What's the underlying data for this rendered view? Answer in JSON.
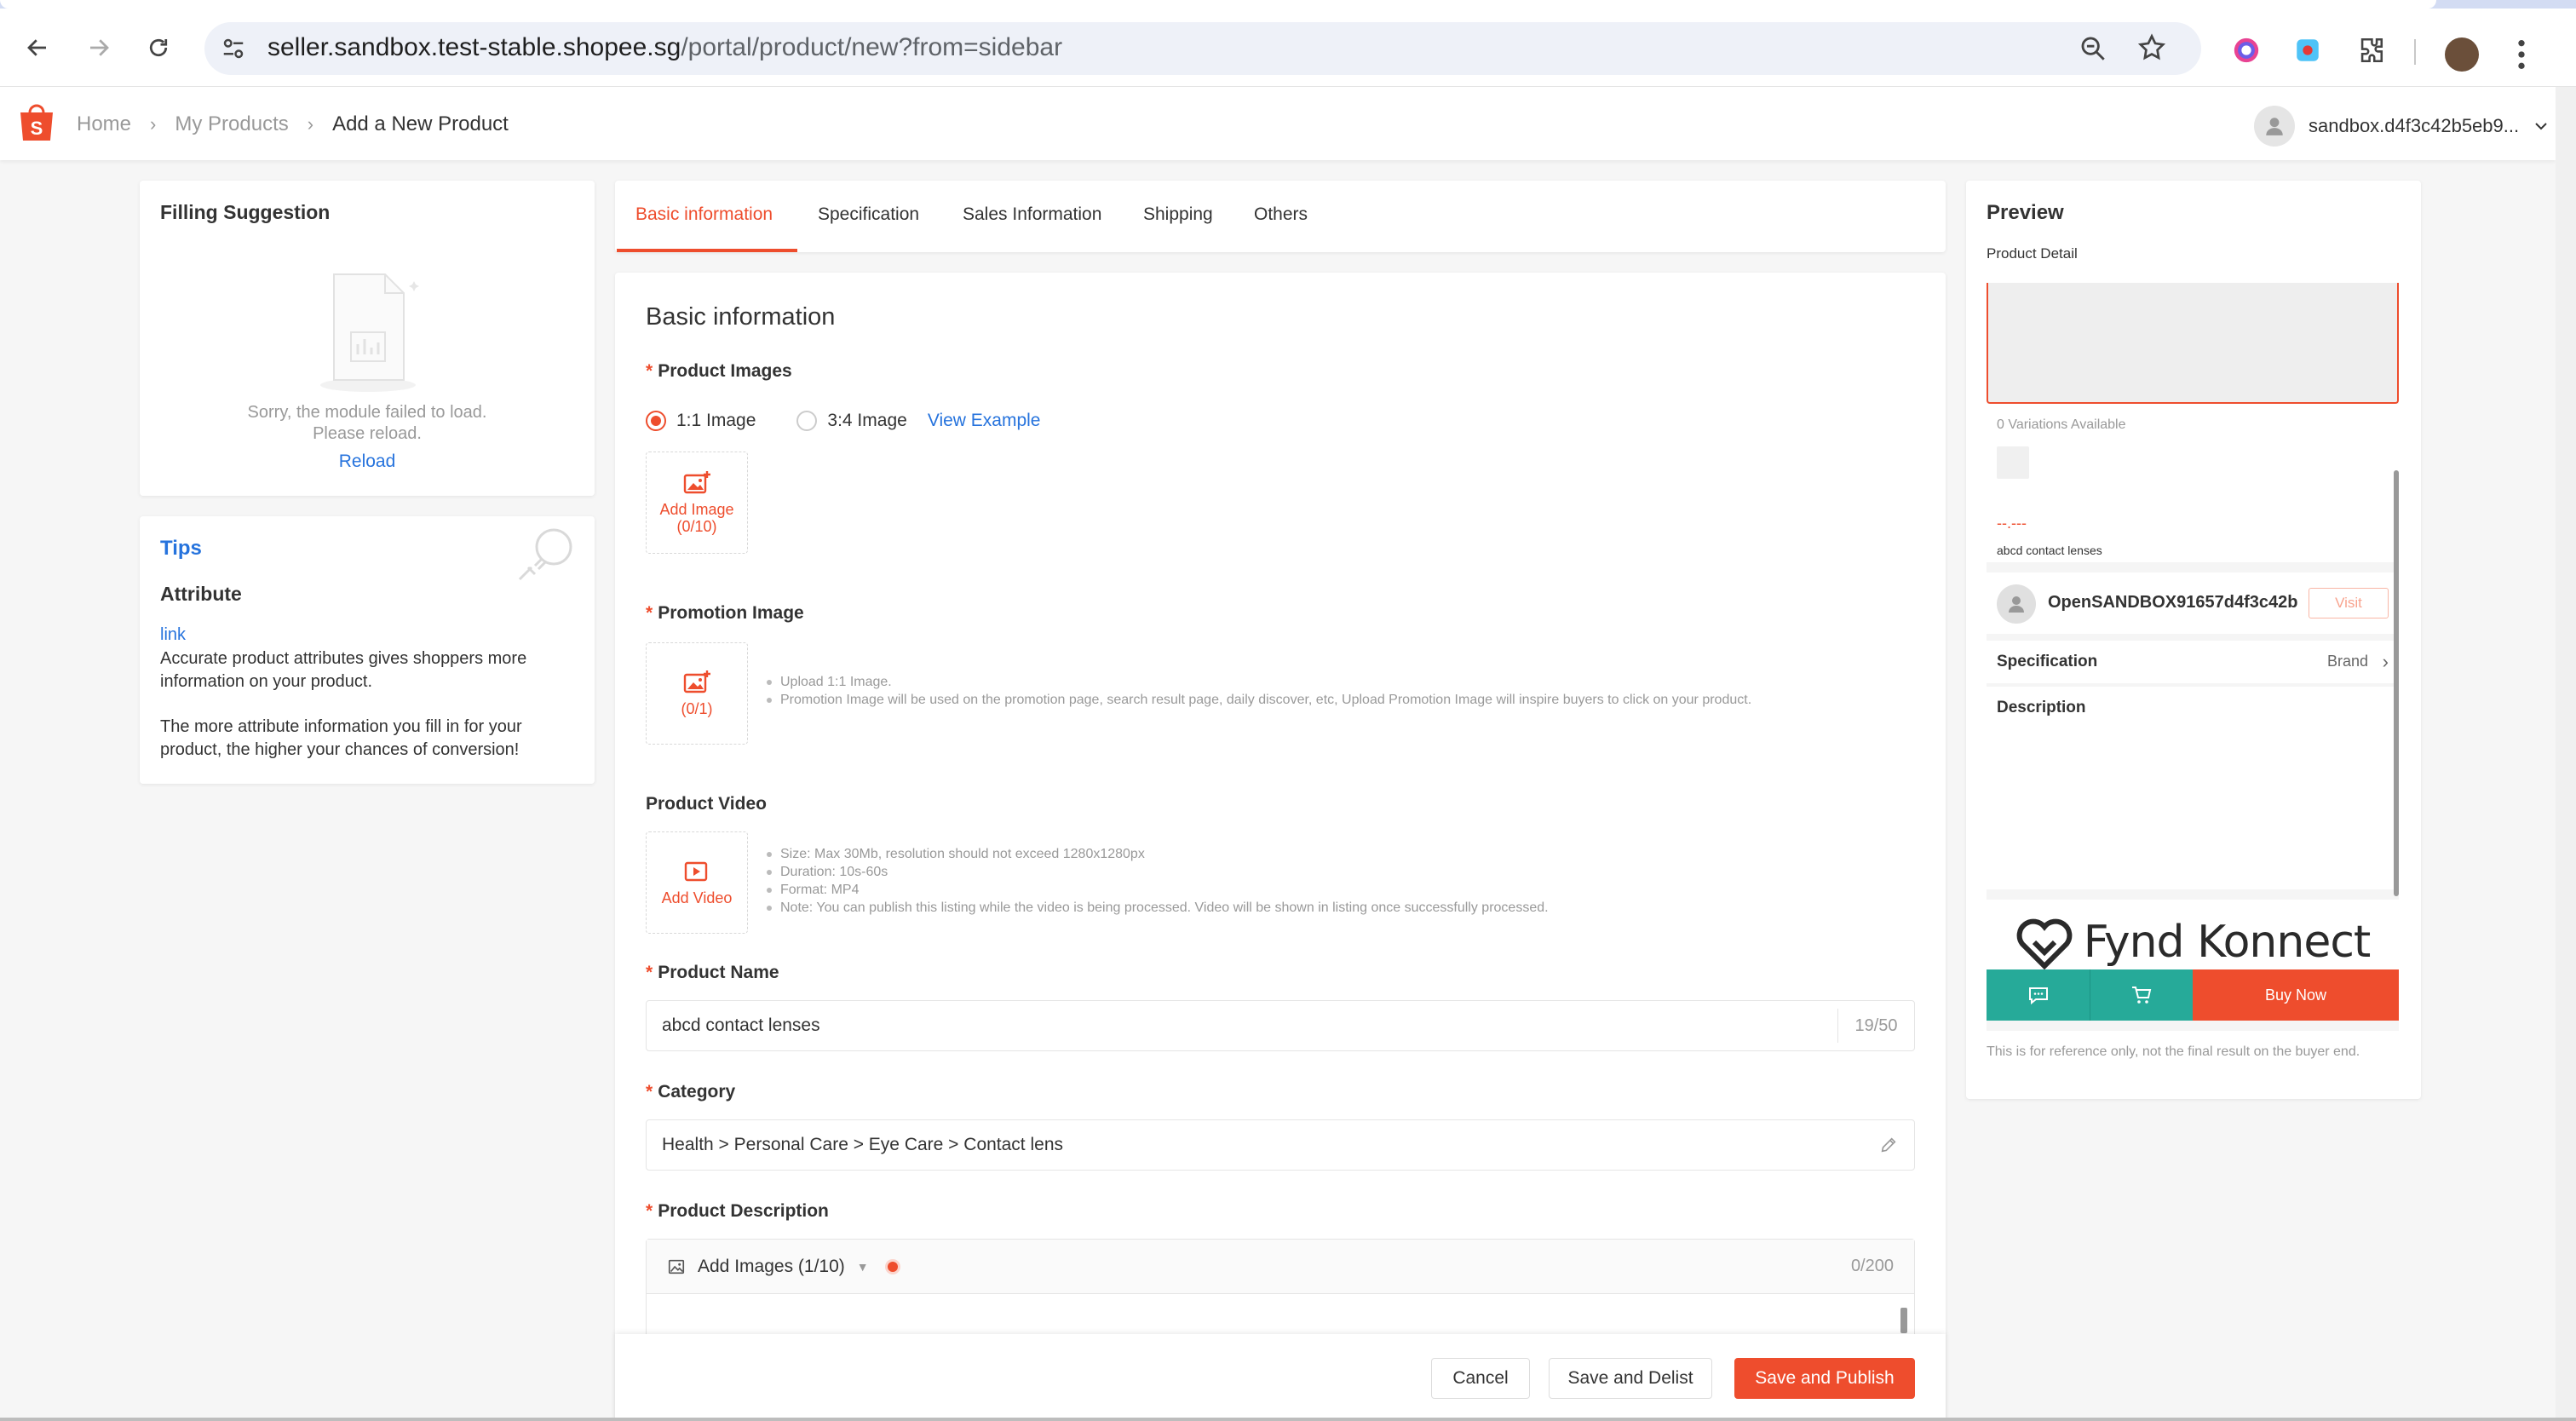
{
  "browser": {
    "url_host": "seller.sandbox.test-stable.shopee.sg",
    "url_path": "/portal/product/new?from=sidebar"
  },
  "header": {
    "breadcrumbs": [
      "Home",
      "My Products",
      "Add a New Product"
    ],
    "account_name": "sandbox.d4f3c42b5eb9..."
  },
  "filling_suggestion": {
    "title": "Filling Suggestion",
    "error_line1": "Sorry, the module failed to load.",
    "error_line2": "Please reload.",
    "reload": "Reload"
  },
  "tips": {
    "title": "Tips",
    "heading": "Attribute",
    "link": "link",
    "para1": "Accurate product attributes gives shoppers more information on your product.",
    "para2": "The more attribute information you fill in for your product, the higher your chances of conversion!"
  },
  "tabs": [
    "Basic information",
    "Specification",
    "Sales Information",
    "Shipping",
    "Others"
  ],
  "form": {
    "section_title": "Basic information",
    "product_images": {
      "label": "Product Images",
      "ratio_1_1": "1:1 Image",
      "ratio_3_4": "3:4 Image",
      "view_example": "View Example",
      "add_label": "Add Image",
      "add_count": "(0/10)"
    },
    "promotion_image": {
      "label": "Promotion Image",
      "add_count": "(0/1)",
      "hint1": "Upload 1:1 Image.",
      "hint2": "Promotion Image will be used on the promotion page, search result page, daily discover, etc,   Upload Promotion Image will inspire buyers to click on your product."
    },
    "product_video": {
      "label": "Product Video",
      "add_label": "Add Video",
      "hint1": "Size: Max 30Mb, resolution should not exceed 1280x1280px",
      "hint2": "Duration: 10s-60s",
      "hint3": "Format: MP4",
      "hint4": "Note: You can publish this listing while the video is being processed. Video will be shown in listing once successfully processed."
    },
    "product_name": {
      "label": "Product Name",
      "value": "abcd contact lenses",
      "count": "19/50"
    },
    "category": {
      "label": "Category",
      "value": "Health > Personal Care > Eye Care > Contact lens"
    },
    "product_description": {
      "label": "Product Description",
      "add_images": "Add Images (1/10)",
      "count": "0/200"
    }
  },
  "actions": {
    "cancel": "Cancel",
    "save_delist": "Save and Delist",
    "save_publish": "Save and Publish"
  },
  "preview": {
    "title": "Preview",
    "subtitle": "Product Detail",
    "variations": "0 Variations Available",
    "price": "--.---",
    "product_name": "abcd contact lenses",
    "shop_name": "OpenSANDBOX91657d4f3c42b",
    "visit": "Visit",
    "spec_label": "Specification",
    "spec_value": "Brand",
    "desc_label": "Description",
    "watermark": "Fynd Konnect",
    "buy_now": "Buy Now",
    "note": "This is for reference only, not the final result on the buyer end."
  },
  "colors": {
    "accent": "#ee4d2d",
    "link": "#2673dd",
    "teal": "#26aa99"
  }
}
